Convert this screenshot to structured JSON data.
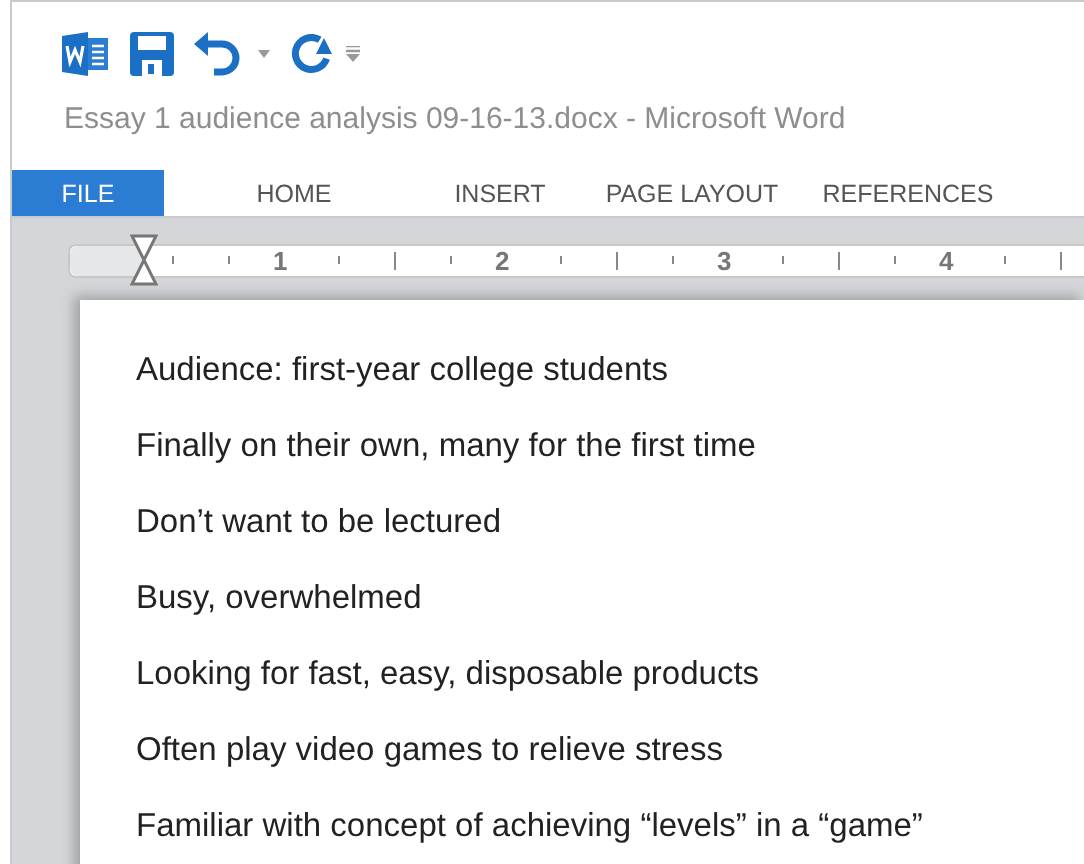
{
  "window": {
    "title": "Essay 1 audience analysis 09-16-13.docx - Microsoft Word"
  },
  "tabs": [
    {
      "label": "FILE",
      "selected": true
    },
    {
      "label": "HOME",
      "selected": false
    },
    {
      "label": "INSERT",
      "selected": false
    },
    {
      "label": "PAGE LAYOUT",
      "selected": false
    },
    {
      "label": "REFERENCES",
      "selected": false
    }
  ],
  "ruler": {
    "labels": [
      "1",
      "2",
      "3",
      "4"
    ]
  },
  "document": {
    "lines": [
      "Audience: first-year college students",
      "Finally on their own, many for the first time",
      "Don’t want to be lectured",
      "Busy, overwhelmed",
      "Looking for fast, easy, disposable products",
      "Often play video games to relieve stress",
      "Familiar with concept of achieving “levels” in a “game”"
    ]
  }
}
